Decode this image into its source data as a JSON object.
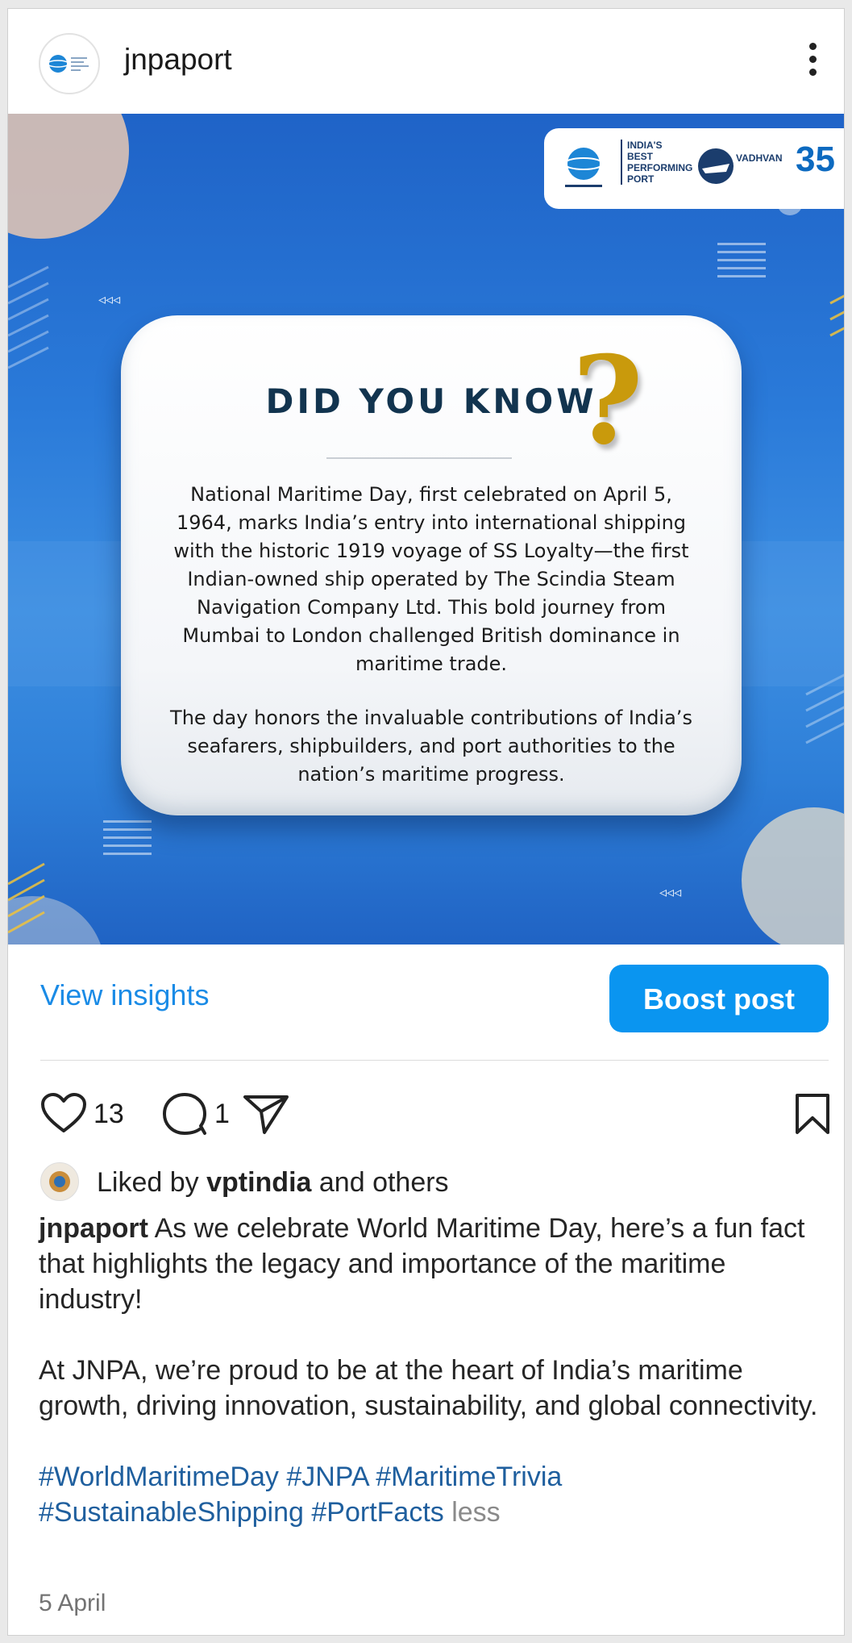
{
  "header": {
    "username": "jnpaport"
  },
  "post": {
    "card_title": "DID YOU KNOW",
    "question_mark": "?",
    "paragraph1_lines": [
      "National Maritime Day, first celebrated on April 5,",
      "1964, marks India’s entry into international shipping",
      "with the historic 1919 voyage of SS Loyalty—the first",
      "Indian-owned ship operated by The Scindia Steam",
      "Navigation Company Ltd. This bold journey from",
      "Mumbai to London challenged British dominance in",
      "maritime trade."
    ],
    "paragraph2_lines": [
      "The day honors the invaluable contributions of India’s",
      "seafarers, shipbuilders, and port authorities to the",
      "nation’s maritime progress."
    ],
    "logo": {
      "line1": "INDIA'S",
      "line2": "BEST",
      "line3": "PERFORMING",
      "line4": "PORT",
      "vadhvan": "VADHVAN",
      "badge": "35"
    },
    "arrows_left": "◃◃◃",
    "arrows_right": "◃◃◃"
  },
  "actions": {
    "view_insights": "View insights",
    "boost_post": "Boost post"
  },
  "stats": {
    "likes": "13",
    "comments": "1"
  },
  "liked_by": {
    "prefix": "Liked by",
    "user": "vptindia",
    "suffix": "and others"
  },
  "caption": {
    "username": "jnpaport",
    "text1": "As we celebrate World Maritime Day, here’s a fun fact that highlights the legacy and importance of the maritime industry!",
    "text2": "At JNPA, we’re proud to be at the heart of India’s maritime growth, driving innovation, sustainability, and global connectivity.",
    "hashtags": "#WorldMaritimeDay #JNPA #MaritimeTrivia #SustainableShipping #PortFacts",
    "less": "less"
  },
  "date": "5 April",
  "colors": {
    "accent": "#0a95f0",
    "link": "#1a8be6",
    "hashtag": "#1f5f9e",
    "post_bg": "#2a7ad9",
    "question_mark": "#c99a0c"
  }
}
